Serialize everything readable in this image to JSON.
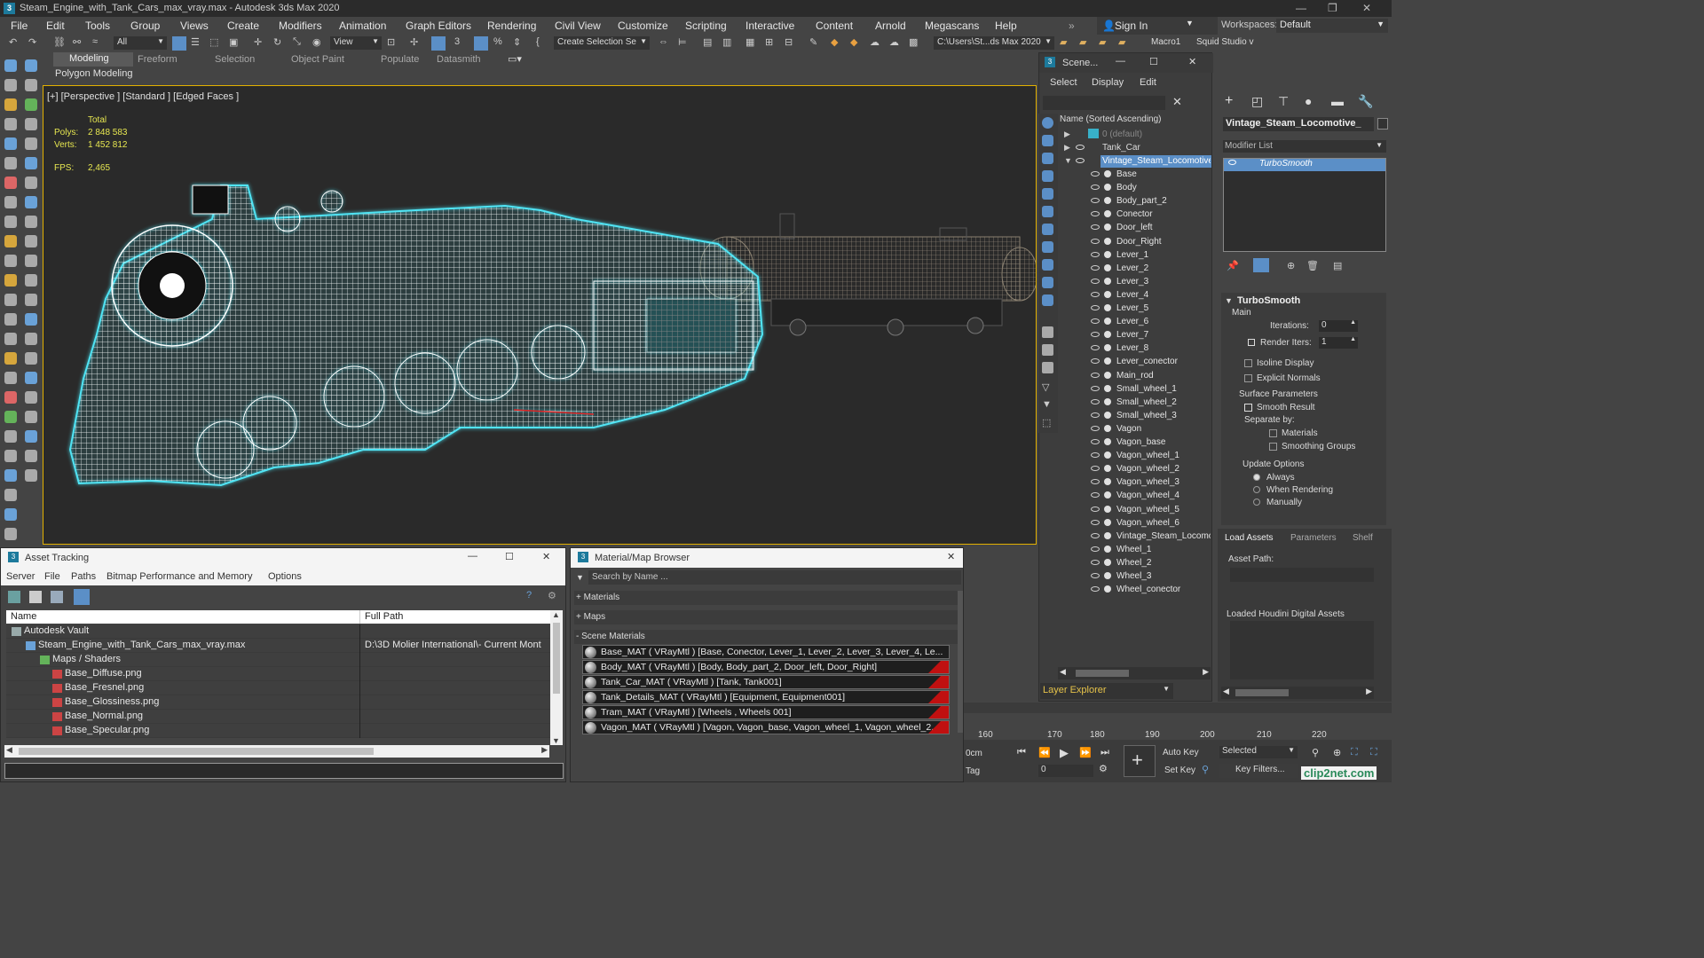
{
  "app": {
    "title": "Steam_Engine_with_Tank_Cars_max_vray.max - Autodesk 3ds Max 2020"
  },
  "menu": [
    "File",
    "Edit",
    "Tools",
    "Group",
    "Views",
    "Create",
    "Modifiers",
    "Animation",
    "Graph Editors",
    "Rendering",
    "Civil View",
    "Customize",
    "Scripting",
    "Interactive",
    "Content",
    "Arnold",
    "Megascans",
    "Help"
  ],
  "signin": "Sign In",
  "workspace_label": "Workspaces:",
  "workspace_value": "Default",
  "toolbar": {
    "filter": "All",
    "view": "View",
    "selection_set": "Create Selection Se",
    "path": "C:\\Users\\St...ds Max 2020",
    "macro": "Macro1",
    "squid": "Squid Studio v"
  },
  "ribbon": {
    "tabs": [
      "Modeling",
      "Freeform",
      "Selection",
      "Object Paint",
      "Populate",
      "Datasmith"
    ],
    "sub": "Polygon Modeling"
  },
  "viewport": {
    "label": "[+] [Perspective ] [Standard ] [Edged Faces ]",
    "total": "Total",
    "polys_label": "Polys:",
    "polys": "2 848 583",
    "verts_label": "Verts:",
    "verts": "1 452 812",
    "fps_label": "FPS:",
    "fps": "2,465"
  },
  "scene": {
    "title": "Scene...",
    "menu": [
      "Select",
      "Display",
      "Edit"
    ],
    "header": "Name (Sorted Ascending)",
    "layers": [
      "0 (default)",
      "Tank_Car",
      "Vintage_Steam_Locomotive"
    ],
    "objects": [
      "Base",
      "Body",
      "Body_part_2",
      "Conector",
      "Door_left",
      "Door_Right",
      "Lever_1",
      "Lever_2",
      "Lever_3",
      "Lever_4",
      "Lever_5",
      "Lever_6",
      "Lever_7",
      "Lever_8",
      "Lever_conector",
      "Main_rod",
      "Small_wheel_1",
      "Small_wheel_2",
      "Small_wheel_3",
      "Vagon",
      "Vagon_base",
      "Vagon_wheel_1",
      "Vagon_wheel_2",
      "Vagon_wheel_3",
      "Vagon_wheel_4",
      "Vagon_wheel_5",
      "Vagon_wheel_6",
      "Vintage_Steam_Locomo",
      "Wheel_1",
      "Wheel_2",
      "Wheel_3",
      "Wheel_conector"
    ],
    "footer": "Layer Explorer"
  },
  "cmd": {
    "object_name": "Vintage_Steam_Locomotive_",
    "modifier_list": "Modifier List",
    "modifier": "TurboSmooth",
    "rollout": "TurboSmooth",
    "main": "Main",
    "iterations_label": "Iterations:",
    "iterations": "0",
    "render_iters_label": "Render Iters:",
    "render_iters": "1",
    "isoline": "Isoline Display",
    "explicit": "Explicit Normals",
    "surface": "Surface Parameters",
    "smooth": "Smooth Result",
    "separate": "Separate by:",
    "materials": "Materials",
    "smoothing": "Smoothing Groups",
    "update": "Update Options",
    "always": "Always",
    "when_rendering": "When Rendering",
    "manually": "Manually"
  },
  "lower": {
    "tabs": [
      "Load Assets",
      "Parameters",
      "Shelf"
    ],
    "asset_path": "Asset Path:",
    "loaded": "Loaded Houdini Digital Assets"
  },
  "asset": {
    "title": "Asset Tracking",
    "menu": [
      "Server",
      "File",
      "Paths",
      "Bitmap Performance and Memory",
      "Options"
    ],
    "col_name": "Name",
    "col_path": "Full Path",
    "rows": [
      {
        "name": "Autodesk Vault",
        "path": ""
      },
      {
        "name": "Steam_Engine_with_Tank_Cars_max_vray.max",
        "path": "D:\\3D Molier International\\- Current Mont"
      },
      {
        "name": "Maps / Shaders",
        "path": ""
      },
      {
        "name": "Base_Diffuse.png",
        "path": ""
      },
      {
        "name": "Base_Fresnel.png",
        "path": ""
      },
      {
        "name": "Base_Glossiness.png",
        "path": ""
      },
      {
        "name": "Base_Normal.png",
        "path": ""
      },
      {
        "name": "Base_Specular.png",
        "path": ""
      }
    ]
  },
  "matbrowser": {
    "title": "Material/Map Browser",
    "search": "Search by Name ...",
    "materials": "+ Materials",
    "maps": "+ Maps",
    "scene_materials": "- Scene Materials",
    "items": [
      "Base_MAT  ( VRayMtl )  [Base, Conector, Lever_1, Lever_2, Lever_3, Lever_4, Le...",
      "Body_MAT  ( VRayMtl )  [Body, Body_part_2, Door_left, Door_Right]",
      "Tank_Car_MAT  ( VRayMtl )  [Tank, Tank001]",
      "Tank_Details_MAT  ( VRayMtl )  [Equipment, Equipment001]",
      "Tram_MAT  ( VRayMtl )  [Wheels , Wheels 001]",
      "Vagon_MAT  ( VRayMtl )  [Vagon, Vagon_base, Vagon_wheel_1, Vagon_wheel_2..."
    ]
  },
  "timeline": {
    "ticks": [
      "160",
      "170",
      "180",
      "190",
      "200",
      "210",
      "220"
    ],
    "cm": "0cm",
    "tag": "Tag",
    "frame": "0",
    "autokey": "Auto Key",
    "selected": "Selected",
    "setkey": "Set Key",
    "keyfilters": "Key Filters..."
  },
  "watermark": "clip2net.com"
}
